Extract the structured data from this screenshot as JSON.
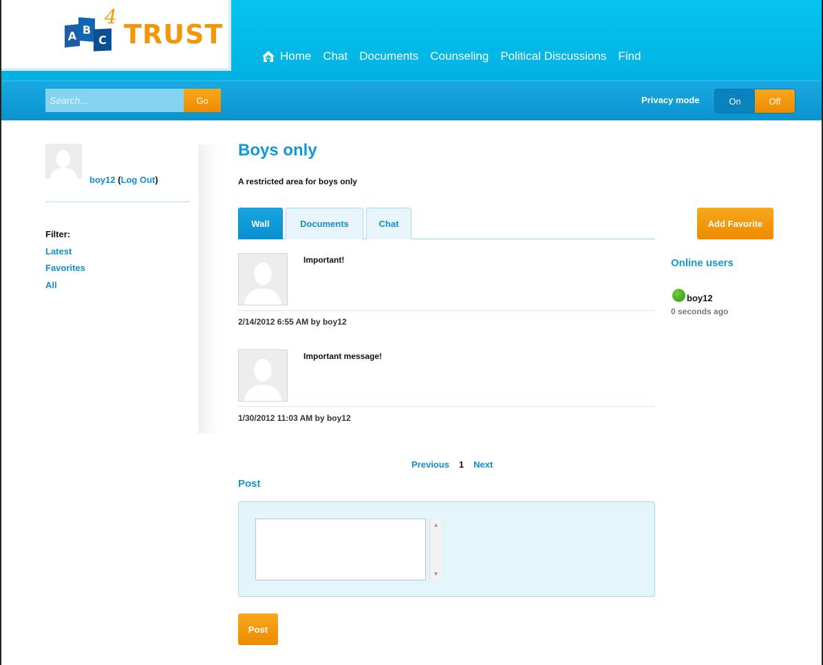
{
  "brand": {
    "logo_letters": [
      "A",
      "B",
      "C"
    ],
    "logo_number": "4",
    "logo_word": "TRUST",
    "accent_blue": "#05c3ef",
    "accent_orange": "#f3960a"
  },
  "nav": {
    "items": [
      {
        "label": "Home",
        "icon": "home-icon"
      },
      {
        "label": "Chat"
      },
      {
        "label": "Documents"
      },
      {
        "label": "Counseling"
      },
      {
        "label": "Political Discussions"
      },
      {
        "label": "Find"
      }
    ]
  },
  "search": {
    "placeholder": "Search...",
    "button_label": "Go"
  },
  "privacy": {
    "label": "Privacy mode",
    "on_label": "On",
    "off_label": "Off",
    "selected": "Off"
  },
  "user": {
    "name": "boy12",
    "logout_label": "Log Out"
  },
  "filter": {
    "label": "Filter:",
    "items": [
      "Latest",
      "Favorites",
      "All"
    ]
  },
  "group": {
    "title": "Boys only",
    "description": "A restricted area for boys only"
  },
  "tabs": [
    {
      "label": "Wall",
      "active": true
    },
    {
      "label": "Documents",
      "active": false
    },
    {
      "label": "Chat",
      "active": false
    }
  ],
  "posts": [
    {
      "text": "Important!",
      "meta": "2/14/2012 6:55 AM by boy12"
    },
    {
      "text": "Important message!",
      "meta": "1/30/2012 11:03 AM by boy12"
    }
  ],
  "pager": {
    "previous": "Previous",
    "current": "1",
    "next": "Next"
  },
  "composer": {
    "heading": "Post",
    "button_label": "Post"
  },
  "right": {
    "favorite_button": "Add Favorite",
    "online_heading": "Online users",
    "online_users": [
      {
        "name": "boy12",
        "since": "0 seconds ago",
        "status_color": "#3faa1c"
      }
    ]
  }
}
